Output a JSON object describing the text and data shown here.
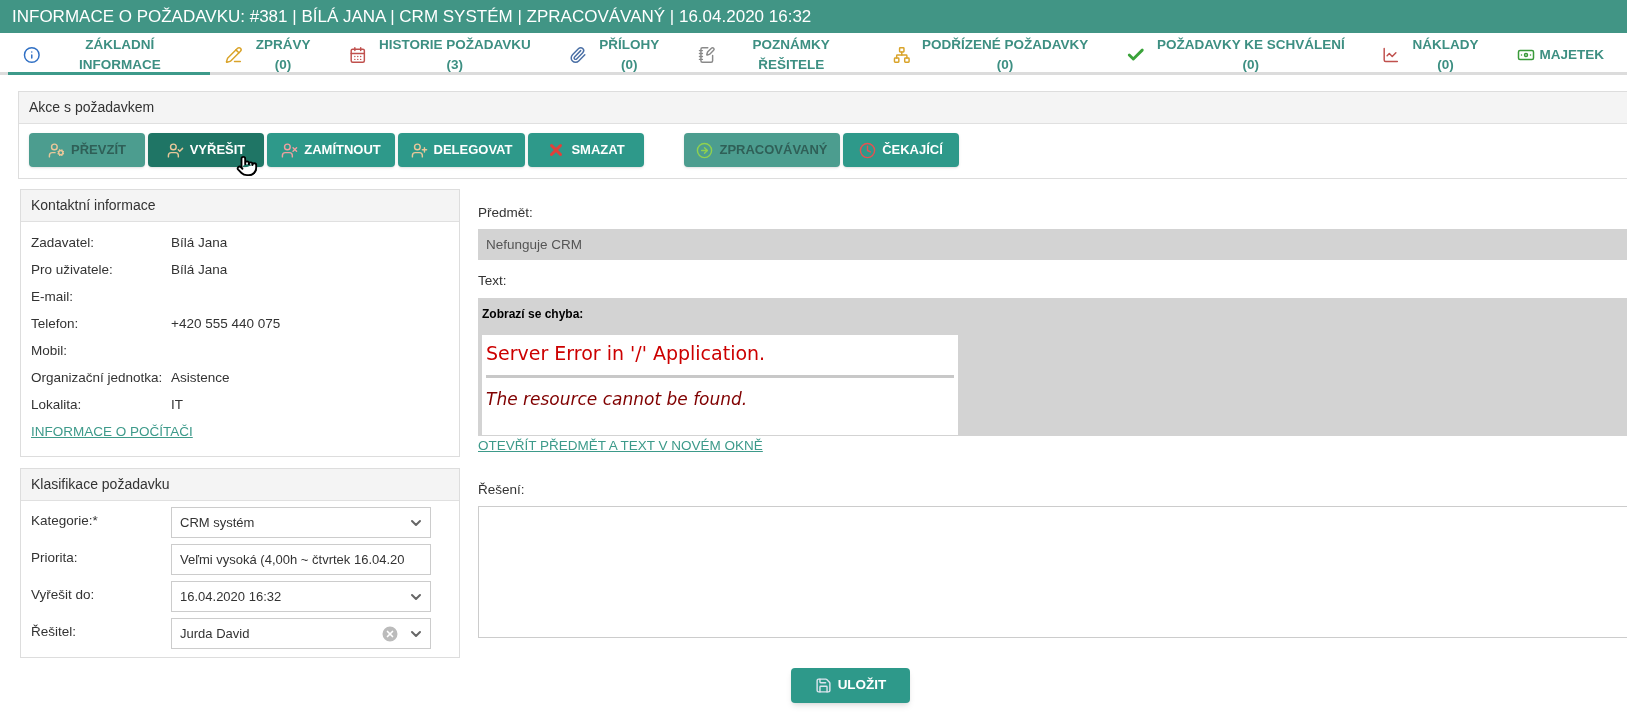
{
  "header": {
    "title": "INFORMACE O POŽADAVKU: #381 | BÍLÁ JANA | CRM SYSTÉM | ZPRACOVÁVANÝ | 16.04.2020 16:32"
  },
  "tabs": [
    {
      "label": "ZÁKLADNÍ INFORMACE",
      "selected": true
    },
    {
      "label": "ZPRÁVY (0)",
      "selected": false
    },
    {
      "label": "HISTORIE POŽADAVKU (3)",
      "selected": false
    },
    {
      "label": "PŘÍLOHY (0)",
      "selected": false
    },
    {
      "label": "POZNÁMKY ŘEŠITELE",
      "selected": false
    },
    {
      "label": "PODŘÍZENÉ POŽADAVKY (0)",
      "selected": false
    },
    {
      "label": "POŽADAVKY KE SCHVÁLENÍ (0)",
      "selected": false
    },
    {
      "label": "NÁKLADY (0)",
      "selected": false
    },
    {
      "label": "MAJETEK",
      "selected": false
    }
  ],
  "actions": {
    "title": "Akce s požadavkem",
    "buttons": [
      {
        "label": "PŘEVZÍT",
        "disabled": true,
        "hovered": false
      },
      {
        "label": "VYŘEŠIT",
        "disabled": false,
        "hovered": true
      },
      {
        "label": "ZAMÍTNOUT",
        "disabled": false,
        "hovered": false
      },
      {
        "label": "DELEGOVAT",
        "disabled": false,
        "hovered": false
      },
      {
        "label": "SMAZAT",
        "disabled": false,
        "hovered": false
      }
    ],
    "status_buttons": [
      {
        "label": "ZPRACOVÁVANÝ",
        "disabled": true,
        "hovered": false
      },
      {
        "label": "ČEKAJÍCÍ",
        "disabled": false,
        "hovered": false
      }
    ]
  },
  "contact": {
    "title": "Kontaktní informace",
    "rows": [
      {
        "label": "Zadavatel:",
        "value": "Bílá Jana"
      },
      {
        "label": "Pro uživatele:",
        "value": "Bílá Jana"
      },
      {
        "label": "E-mail:"
      },
      {
        "label": "Telefon:",
        "value": "+420 555 440 075"
      },
      {
        "label": "Mobil:"
      },
      {
        "label": "Organizační jednotka:",
        "value": "Asistence"
      },
      {
        "label": "Lokalita:",
        "value": "IT"
      }
    ],
    "link": "INFORMACE O POČÍTAČI"
  },
  "classification": {
    "title": "Klasifikace požadavku",
    "fields": [
      {
        "label": "Kategorie:*",
        "value": "CRM systém",
        "kind": "select"
      },
      {
        "label": "Priorita:",
        "value": "Veľmi vysoká (4,00h ~ čtvrtek 16.04.20",
        "kind": "text"
      },
      {
        "label": "Vyřešit do:",
        "value": "16.04.2020 16:32",
        "kind": "select"
      },
      {
        "label": "Řešitel:",
        "value": "Jurda David",
        "kind": "clearable"
      }
    ]
  },
  "subject": {
    "label": "Předmět:",
    "value": "Nefunguje CRM"
  },
  "text": {
    "label": "Text:",
    "intro": "Zobrazí se chyba:",
    "embedded": {
      "heading": "Server Error in '/' Application.",
      "message": "The resource cannot be found."
    }
  },
  "open_link": "OTEVŘÍT PŘEDMĚT A TEXT V NOVÉM OKNĚ",
  "solution": {
    "label": "Řešení:"
  },
  "save_button": {
    "label": "ULOŽIT"
  }
}
